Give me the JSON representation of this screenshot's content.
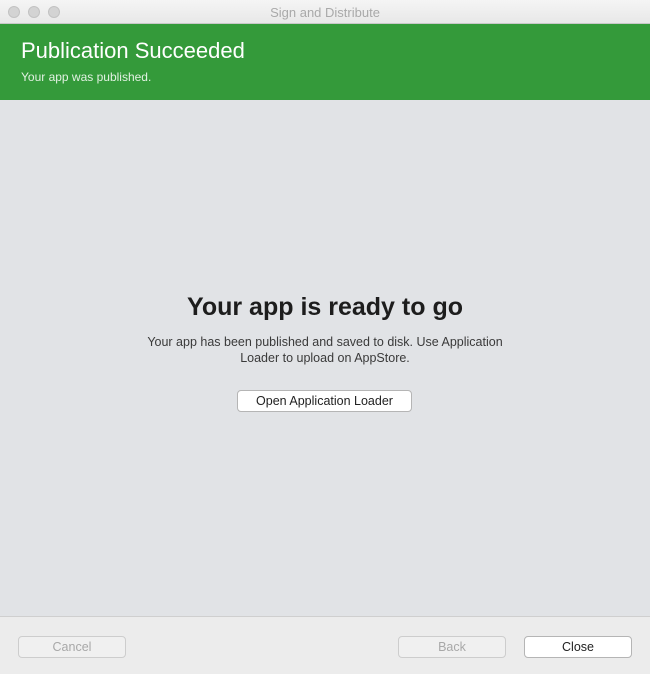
{
  "window": {
    "title": "Sign and Distribute"
  },
  "banner": {
    "title": "Publication Succeeded",
    "subtitle": "Your app was published.",
    "background_color": "#349a3a"
  },
  "main": {
    "headline": "Your app is ready to go",
    "description": "Your app has been published and saved to disk. Use Application Loader to upload on AppStore.",
    "open_loader_label": "Open Application Loader"
  },
  "footer": {
    "cancel_label": "Cancel",
    "cancel_enabled": false,
    "back_label": "Back",
    "back_enabled": false,
    "close_label": "Close",
    "close_enabled": true
  }
}
